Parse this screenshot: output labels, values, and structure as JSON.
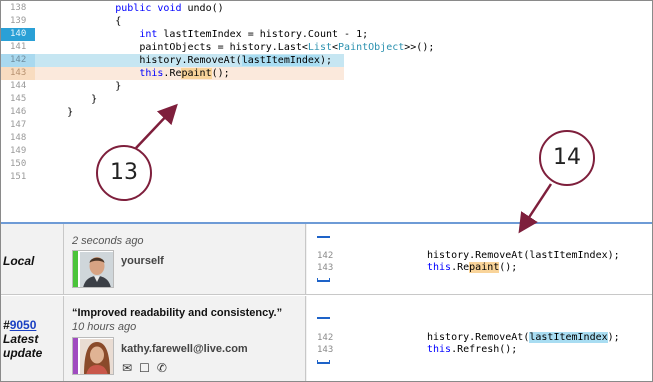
{
  "editor": {
    "lines": [
      {
        "num": "138",
        "state": "normal",
        "segments": [
          {
            "t": "            "
          },
          {
            "t": "public",
            "c": "kw"
          },
          {
            "t": " "
          },
          {
            "t": "void",
            "c": "kw"
          },
          {
            "t": " undo()"
          }
        ]
      },
      {
        "num": "139",
        "state": "normal",
        "segments": [
          {
            "t": "            {"
          }
        ]
      },
      {
        "num": "140",
        "state": "sel",
        "segments": [
          {
            "t": "                "
          },
          {
            "t": "int",
            "c": "kw"
          },
          {
            "t": " lastItemIndex = history.Count - 1;"
          }
        ]
      },
      {
        "num": "141",
        "state": "normal",
        "segments": [
          {
            "t": "                paintObjects = history.Last<"
          },
          {
            "t": "List",
            "c": "ty"
          },
          {
            "t": "<"
          },
          {
            "t": "PaintObject",
            "c": "ty"
          },
          {
            "t": ">>();"
          }
        ]
      },
      {
        "num": "142",
        "state": "mark",
        "segments": [
          {
            "t": "                history.RemoveAt("
          },
          {
            "t": "lastItemIndex",
            "c": "hl-blue"
          },
          {
            "t": ");"
          }
        ]
      },
      {
        "num": "143",
        "state": "mod",
        "segments": [
          {
            "t": "                "
          },
          {
            "t": "this",
            "c": "kw"
          },
          {
            "t": ".Re"
          },
          {
            "t": "paint",
            "c": "hl-orange"
          },
          {
            "t": "();"
          }
        ]
      },
      {
        "num": "144",
        "state": "normal",
        "segments": [
          {
            "t": "            }"
          }
        ]
      },
      {
        "num": "145",
        "state": "normal",
        "segments": [
          {
            "t": "        }"
          }
        ]
      },
      {
        "num": "146",
        "state": "normal",
        "segments": [
          {
            "t": "    }"
          }
        ]
      },
      {
        "num": "147",
        "state": "normal",
        "segments": []
      },
      {
        "num": "148",
        "state": "normal",
        "segments": []
      },
      {
        "num": "149",
        "state": "normal",
        "segments": []
      },
      {
        "num": "150",
        "state": "normal",
        "segments": []
      },
      {
        "num": "151",
        "state": "normal",
        "segments": []
      }
    ]
  },
  "history": {
    "local": {
      "label": "Local",
      "time": "2 seconds ago",
      "author": "yourself",
      "line_a": "142",
      "line_b": "143",
      "code_a": "history.RemoveAt(lastItemIndex);",
      "code_b_prefix": "this",
      "code_b_mid": ".Re",
      "code_b_hl": "paint",
      "code_b_suffix": "();"
    },
    "latest": {
      "hash": "9050",
      "label_prefix": "#",
      "label_line2": "Latest",
      "label_line3": "update",
      "message": "“Improved readability and consistency.”",
      "time": "10 hours ago",
      "author": "kathy.farewell@live.com",
      "line_a": "142",
      "line_b": "143",
      "code_a_prefix": "history.RemoveAt(",
      "code_a_hl": "lastItemIndex",
      "code_a_suffix": ");",
      "code_b_prefix": "this",
      "code_b_suffix": ".Refresh();"
    }
  },
  "callouts": {
    "a": "13",
    "b": "14"
  },
  "colors": {
    "accent": "#2aa0d6",
    "callout_border": "#7e1f3c",
    "author_bar_local": "#4bc43a",
    "author_bar_latest": "#a04bc0"
  },
  "icons": [
    "mail-icon",
    "chat-icon",
    "phone-icon"
  ]
}
